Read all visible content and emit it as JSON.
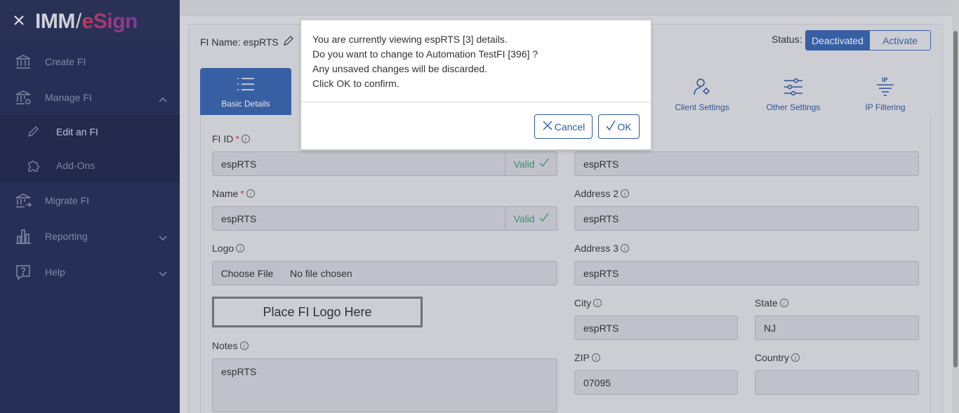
{
  "sidebar": {
    "logo_imm": "IMM",
    "logo_slash": "/",
    "logo_esign": "eSign",
    "items": [
      {
        "label": "Create FI"
      },
      {
        "label": "Manage FI"
      },
      {
        "label": "Edit an FI"
      },
      {
        "label": "Add-Ons"
      },
      {
        "label": "Migrate FI"
      },
      {
        "label": "Reporting"
      },
      {
        "label": "Help"
      }
    ]
  },
  "header": {
    "fi_name": "FI Name: espRTS",
    "status_label": "Status:",
    "status_options": [
      "Deactivated",
      "Activate"
    ]
  },
  "tabs": [
    {
      "label": "Basic Details"
    },
    {
      "label": "Client Settings"
    },
    {
      "label": "Other Settings"
    },
    {
      "label": "IP Filtering"
    }
  ],
  "form": {
    "fi_id": {
      "label": "FI ID",
      "value": "espRTS",
      "status": "Valid"
    },
    "name": {
      "label": "Name",
      "value": "espRTS",
      "status": "Valid"
    },
    "logo": {
      "label": "Logo",
      "button": "Choose File",
      "file": "No file chosen",
      "placeholder": "Place FI Logo Here"
    },
    "notes": {
      "label": "Notes",
      "value": "espRTS"
    },
    "address1": {
      "value": "espRTS"
    },
    "address2": {
      "label": "Address 2",
      "value": "espRTS"
    },
    "address3": {
      "label": "Address 3",
      "value": "espRTS"
    },
    "city": {
      "label": "City",
      "value": "espRTS"
    },
    "state": {
      "label": "State",
      "value": "NJ"
    },
    "zip": {
      "label": "ZIP",
      "value": "07095"
    },
    "country": {
      "label": "Country",
      "value": ""
    }
  },
  "modal": {
    "lines": [
      "You are currently viewing espRTS [3] details.",
      "Do you want to change to Automation TestFI [396] ?",
      "Any unsaved changes will be discarded.",
      "Click OK to confirm."
    ],
    "cancel": "Cancel",
    "ok": "OK"
  },
  "colors": {
    "sidebar_bg": "#28305a",
    "accent": "#3a67b3",
    "valid": "#3ea36a",
    "required": "#d04040"
  }
}
